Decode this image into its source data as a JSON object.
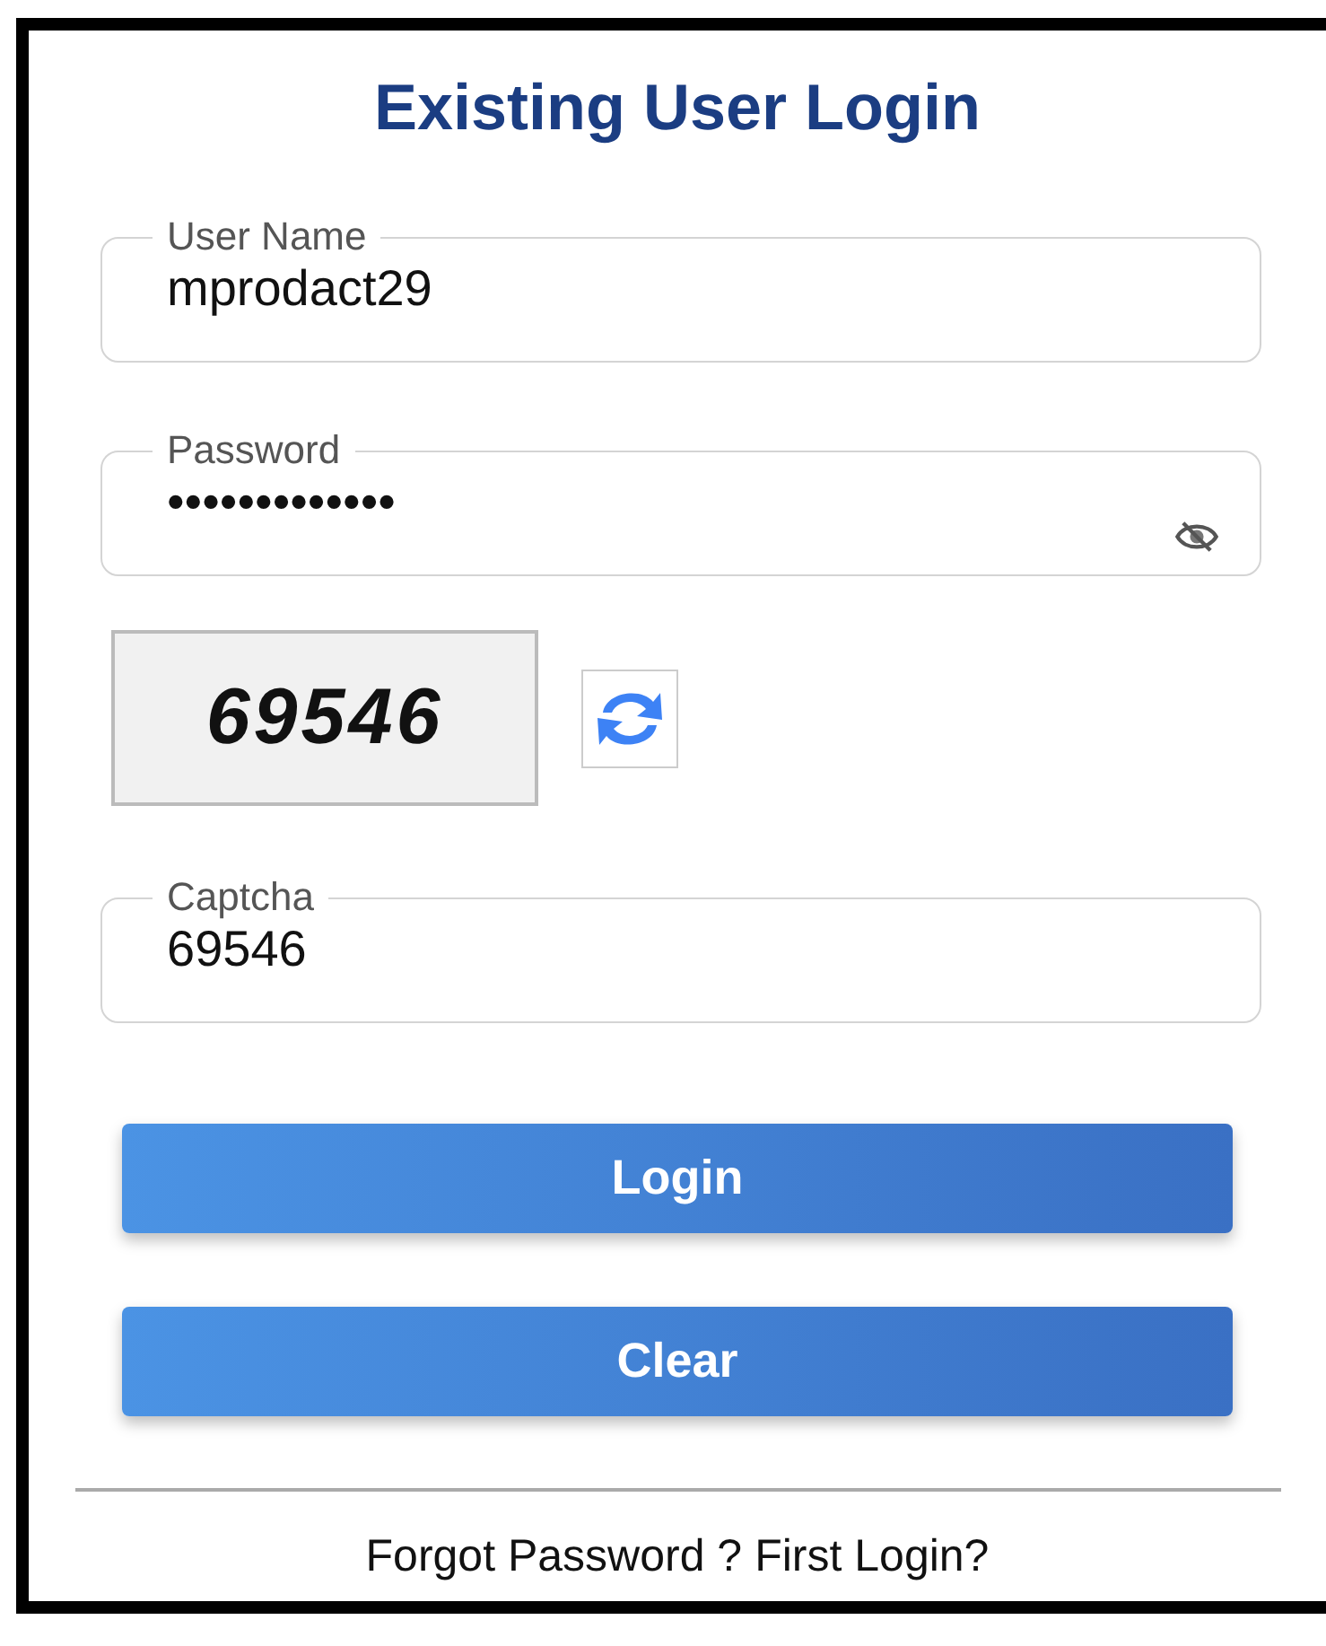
{
  "title": "Existing User Login",
  "fields": [
    {
      "kind": "text",
      "label": "User Name",
      "value": "mprodact29"
    },
    {
      "kind": "password",
      "label": "Password",
      "value": "•••••••••••••",
      "password_visible": false
    },
    {
      "kind": "captcha_image",
      "text": "69546"
    },
    {
      "kind": "text",
      "label": "Captcha",
      "value": "69546"
    }
  ],
  "buttons": [
    "Login",
    "Clear"
  ],
  "links": [
    "Forgot Password ?",
    "First Login?"
  ]
}
